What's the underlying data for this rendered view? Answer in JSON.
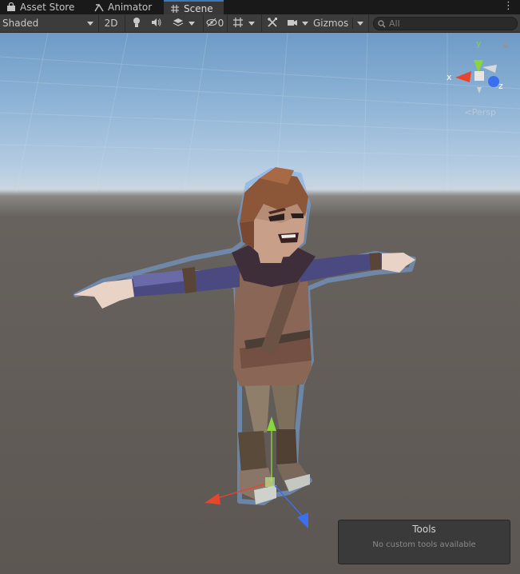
{
  "tabs": [
    {
      "label": "Asset Store",
      "icon": "shopping-bag-icon"
    },
    {
      "label": "Animator",
      "icon": "animator-icon"
    },
    {
      "label": "Scene",
      "icon": "grid-icon",
      "active": true
    }
  ],
  "toolbar": {
    "draw_mode": "Shaded",
    "mode_2d": "2D",
    "hidden_count": "0",
    "gizmos": "Gizmos",
    "search_placeholder": "All"
  },
  "scene": {
    "projection_label": "Persp",
    "axis_labels": {
      "y": "y",
      "x": "x",
      "z": "z"
    }
  },
  "tools_overlay": {
    "title": "Tools",
    "message": "No custom tools available"
  },
  "colors": {
    "accent": "#3a79bb",
    "axis_x": "#e8442f",
    "axis_y": "#8ad53a",
    "axis_z": "#3a6ff0"
  }
}
